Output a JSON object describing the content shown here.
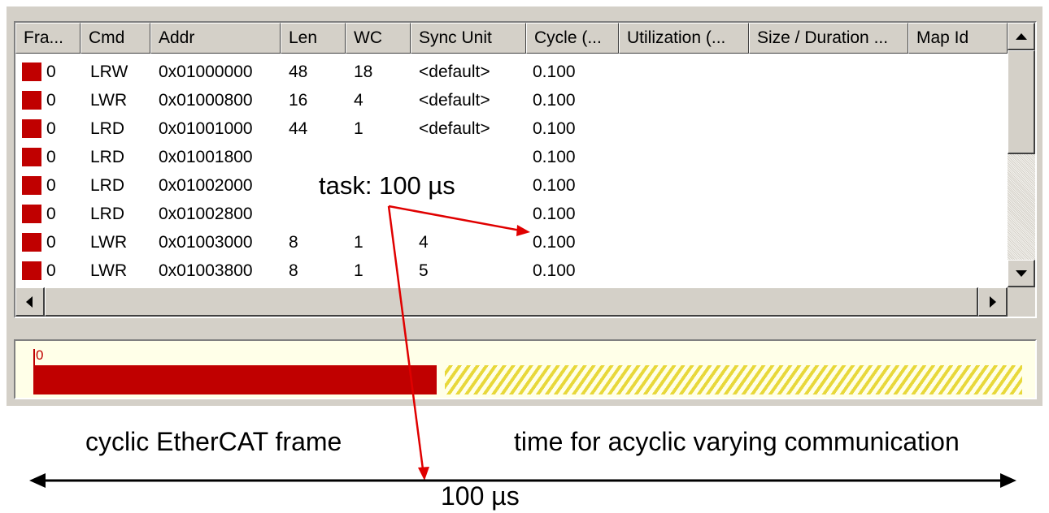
{
  "table": {
    "columns": [
      "Fra...",
      "Cmd",
      "Addr",
      "Len",
      "WC",
      "Sync Unit",
      "Cycle (...",
      "Utilization (...",
      "Size / Duration ...",
      "Map Id"
    ],
    "rows": [
      {
        "frame": "0",
        "cmd": "LRW",
        "addr": "0x01000000",
        "len": "48",
        "wc": "18",
        "sync": "<default>",
        "cycle": "0.100"
      },
      {
        "frame": "0",
        "cmd": "LWR",
        "addr": "0x01000800",
        "len": "16",
        "wc": "4",
        "sync": "<default>",
        "cycle": "0.100"
      },
      {
        "frame": "0",
        "cmd": "LRD",
        "addr": "0x01001000",
        "len": "44",
        "wc": "1",
        "sync": "<default>",
        "cycle": "0.100"
      },
      {
        "frame": "0",
        "cmd": "LRD",
        "addr": "0x01001800",
        "len": "",
        "wc": "",
        "sync": "",
        "cycle": "0.100"
      },
      {
        "frame": "0",
        "cmd": "LRD",
        "addr": "0x01002000",
        "len": "",
        "wc": "",
        "sync": "",
        "cycle": "0.100"
      },
      {
        "frame": "0",
        "cmd": "LRD",
        "addr": "0x01002800",
        "len": "",
        "wc": "",
        "sync": "",
        "cycle": "0.100"
      },
      {
        "frame": "0",
        "cmd": "LWR",
        "addr": "0x01003000",
        "len": "8",
        "wc": "1",
        "sync": "4",
        "cycle": "0.100"
      },
      {
        "frame": "0",
        "cmd": "LWR",
        "addr": "0x01003800",
        "len": "8",
        "wc": "1",
        "sync": "5",
        "cycle": "0.100"
      }
    ],
    "frame_color": "#c00000"
  },
  "timeline": {
    "frame_index": "0",
    "frame_color": "#c00000",
    "acyclic_color": "#e8d83a"
  },
  "annotations": {
    "task_label": "task: 100 µs",
    "cyclic_label": "cyclic EtherCAT frame",
    "acyclic_label": "time for acyclic varying communication",
    "duration_label": "100 µs",
    "arrow_color": "#e00000"
  }
}
